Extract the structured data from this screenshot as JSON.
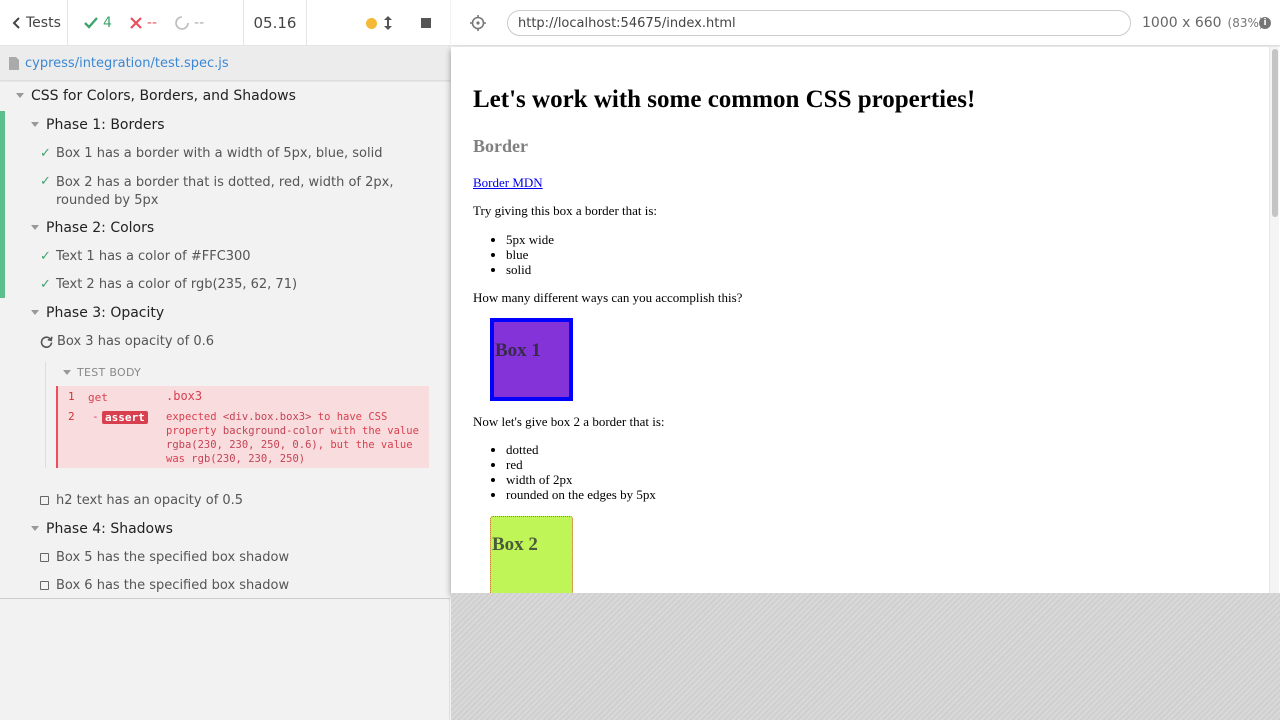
{
  "topbar": {
    "tests_label": "Tests",
    "passed": "4",
    "failed": "--",
    "pending": "--",
    "duration": "05.16"
  },
  "spec": {
    "path": "cypress/integration/test.spec.js"
  },
  "runnables": {
    "root_suite": "CSS for Colors, Borders, and Shadows",
    "phase1": {
      "title": "Phase 1: Borders",
      "test1": "Box 1 has a border with a width of 5px, blue, solid",
      "test2_line1": "Box 2 has a border that is dotted, red, width of 2px,",
      "test2_line2": "rounded by 5px"
    },
    "phase2": {
      "title": "Phase 2: Colors",
      "test1": "Text 1 has a color of #FFC300",
      "test2": "Text 2 has a color of rgb(235, 62, 71)"
    },
    "phase3": {
      "title": "Phase 3: Opacity",
      "test1": "Box 3 has opacity of 0.6",
      "test_body_label": "TEST BODY",
      "cmd1": {
        "num": "1",
        "name": "get",
        "message": ".box3"
      },
      "cmd2": {
        "num": "2",
        "dash": "-",
        "name": "assert",
        "msg_expected": "expected",
        "msg_subject": "<div.box.box3>",
        "msg_to_have": "to have CSS property",
        "msg_prop": "background-color",
        "msg_with_value": "with the value",
        "msg_expected_value": "rgba(230, 230, 250, 0.6)",
        "msg_but": ", but the value was",
        "msg_actual_value": "rgb(230, 230, 250)"
      },
      "test2": "h2 text has an opacity of 0.5"
    },
    "phase4": {
      "title": "Phase 4: Shadows",
      "test1": "Box 5 has the specified box shadow",
      "test2": "Box 6 has the specified box shadow"
    }
  },
  "aut_header": {
    "url": "http://localhost:54675/index.html",
    "viewport": "1000 x 660",
    "scale": "(83%)"
  },
  "aut": {
    "h1": "Let's work with some common CSS properties!",
    "h2": "Border",
    "link": "Border MDN",
    "p1": "Try giving this box a border that is:",
    "list1": [
      "5px wide",
      "blue",
      "solid"
    ],
    "p2": "How many different ways can you accomplish this?",
    "box1": "Box 1",
    "p3": "Now let's give box 2 a border that is:",
    "list2": [
      "dotted",
      "red",
      "width of 2px",
      "rounded on the edges by 5px"
    ],
    "box2": "Box 2"
  },
  "colors": {
    "pass": "#3fa36f",
    "fail": "#e94f5f",
    "running": "#f5b938",
    "link": "#3a88d4"
  },
  "icons": [
    "chevron-left-icon",
    "checkmark-icon",
    "x-icon",
    "spinner-icon",
    "dot-icon",
    "resize-arrows-icon",
    "stop-icon",
    "file-icon",
    "crosshair-icon",
    "info-icon",
    "refresh-icon"
  ]
}
